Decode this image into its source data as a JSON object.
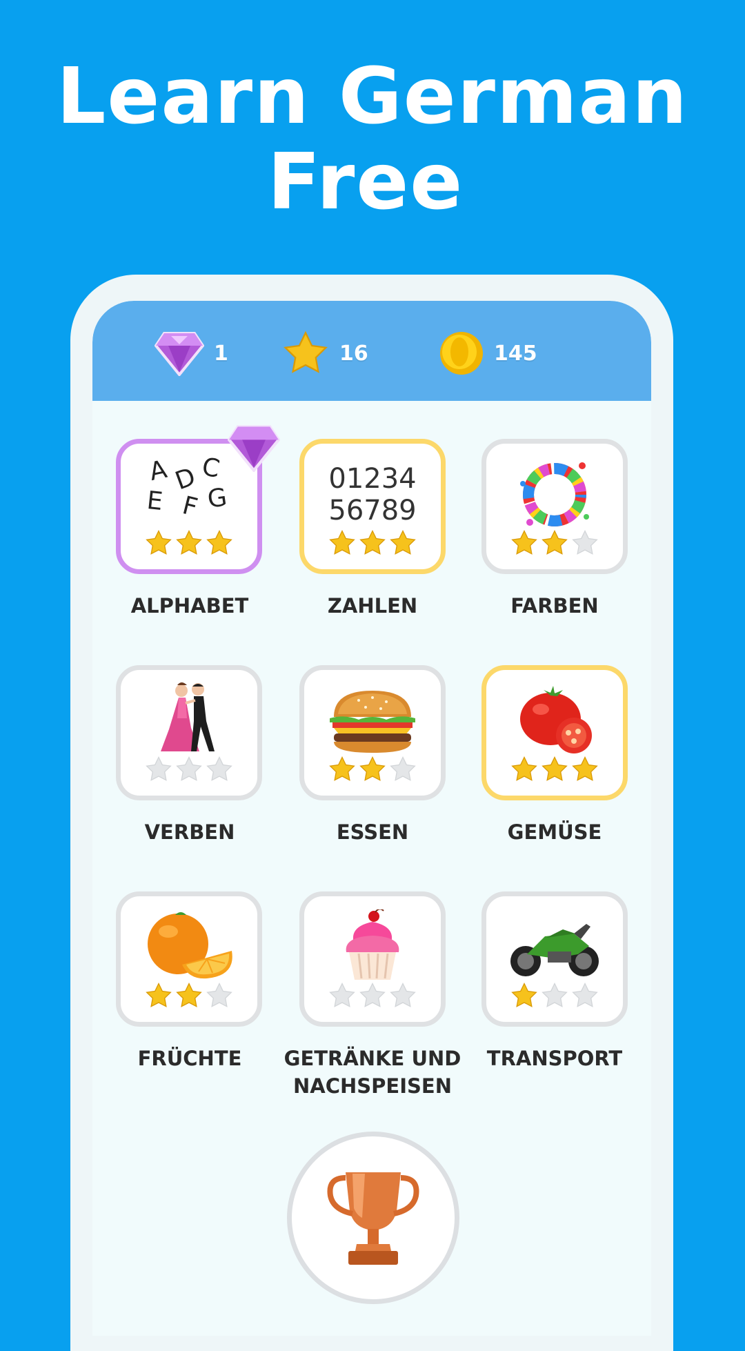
{
  "headline": {
    "line1": "Learn German",
    "line2": "Free"
  },
  "stats": {
    "gems": {
      "icon": "diamond-icon",
      "value": "1"
    },
    "stars": {
      "icon": "star-icon",
      "value": "16"
    },
    "coins": {
      "icon": "coin-icon",
      "value": "145"
    }
  },
  "categories": [
    {
      "label": "ALPHABET",
      "stars": 3,
      "highlight": "purple",
      "art": "alphabet-letters",
      "letters": [
        "A",
        "D",
        "C",
        "E",
        "F",
        "G"
      ]
    },
    {
      "label": "ZAHLEN",
      "stars": 3,
      "highlight": "gold",
      "art": "numbers",
      "numbers_line1": "01234",
      "numbers_line2": "56789"
    },
    {
      "label": "FARBEN",
      "stars": 2,
      "highlight": "none",
      "art": "paint-splash-icon"
    },
    {
      "label": "VERBEN",
      "stars": 0,
      "highlight": "none",
      "art": "dancers-icon"
    },
    {
      "label": "ESSEN",
      "stars": 2,
      "highlight": "none",
      "art": "burger-icon"
    },
    {
      "label": "GEMÜSE",
      "stars": 3,
      "highlight": "gold",
      "art": "tomato-icon"
    },
    {
      "label": "FRÜCHTE",
      "stars": 2,
      "highlight": "none",
      "art": "orange-icon"
    },
    {
      "label_line1": "GETRÄNKE UND",
      "label_line2": "NACHSPEISEN",
      "stars": 0,
      "highlight": "none",
      "art": "cupcake-icon"
    },
    {
      "label": "TRANSPORT",
      "stars": 1,
      "highlight": "none",
      "art": "motorcycle-icon"
    }
  ],
  "trophy": {
    "icon": "trophy-icon"
  },
  "colors": {
    "background": "#08a0ef",
    "topbar": "#5aaeed",
    "purple": "#cf8ff0",
    "gold": "#fcd86a",
    "star": "#f6c21c"
  }
}
